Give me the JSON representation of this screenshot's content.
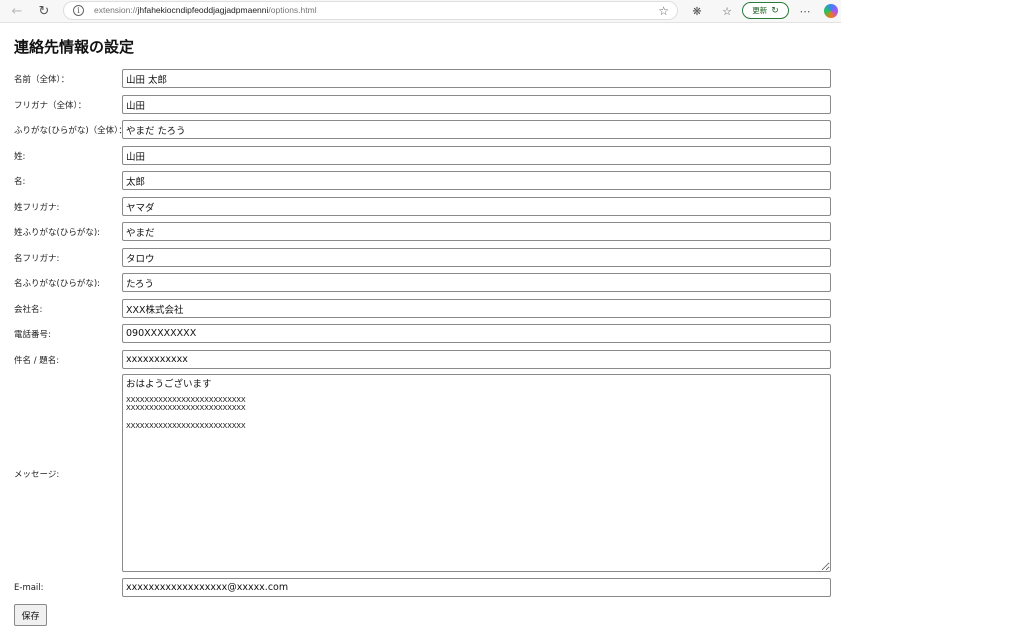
{
  "browser": {
    "url_prefix": "extension://",
    "url_host": "jhfahekiocndipfeoddjagjadpmaenni",
    "url_path": "/options.html",
    "update_label": "更新"
  },
  "page": {
    "title": "連絡先情報の設定"
  },
  "form": {
    "fields": [
      {
        "label": "名前（全体）：",
        "value": "山田 太郎"
      },
      {
        "label": "フリガナ（全体）：",
        "value": "山田"
      },
      {
        "label": "ふりがな(ひらがな)（全体）：",
        "value": "やまだ たろう"
      },
      {
        "label": "姓:",
        "value": "山田"
      },
      {
        "label": "名:",
        "value": "太郎"
      },
      {
        "label": "姓フリガナ:",
        "value": "ヤマダ"
      },
      {
        "label": "姓ふりがな(ひらがな):",
        "value": "やまだ"
      },
      {
        "label": "名フリガナ:",
        "value": "タロウ"
      },
      {
        "label": "名ふりがな(ひらがな):",
        "value": "たろう"
      },
      {
        "label": "会社名:",
        "value": "XXX株式会社"
      },
      {
        "label": "電話番号:",
        "value": "090XXXXXXXX"
      },
      {
        "label": "件名 / 題名:",
        "value": "xxxxxxxxxxx"
      }
    ],
    "message": {
      "label": "メッセージ:",
      "lines": [
        "おはようございます",
        "",
        "XXXXXXXXXXXXXXXXXXXXXXXXXX",
        "XXXXXXXXXXXXXXXXXXXXXXXXXX",
        "",
        "XXXXXXXXXXXXXXXXXXXXXXXXXX"
      ]
    },
    "email": {
      "label": "E-mail:",
      "value": "xxxxxxxxxxxxxxxxxx@xxxxx.com"
    },
    "save_label": "保存"
  }
}
